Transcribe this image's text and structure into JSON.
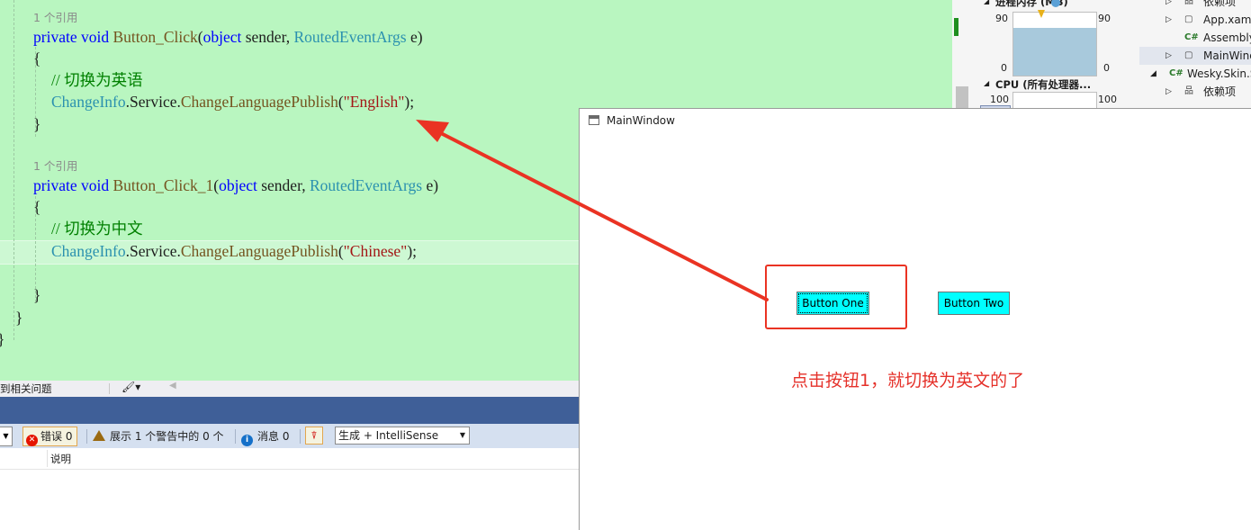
{
  "editor": {
    "ref1": "1 个引用",
    "method1": {
      "kw": "private void",
      "name": "Button_Click",
      "p1type": "object",
      "p1name": "sender,",
      "p2type": "RoutedEventArgs",
      "p2name": "e)"
    },
    "open_brace": "{",
    "close_brace": "}",
    "comment1": "// 切换为英语",
    "call1": {
      "cls": "ChangeInfo",
      "dot1": ".Service.",
      "method": "ChangeLanguagePublish",
      "arg": "\"English\"",
      "end": ");"
    },
    "ref2": "1 个引用",
    "method2": {
      "kw": "private void",
      "name": "Button_Click_1",
      "p1type": "object",
      "p1name": "sender,",
      "p2type": "RoutedEventArgs",
      "p2name": "e)"
    },
    "comment2": "// 切换为中文",
    "call2": {
      "cls": "ChangeInfo",
      "dot1": ".Service.",
      "method": "ChangeLanguagePublish",
      "arg": "\"Chinese\"",
      "end": ");"
    }
  },
  "status_strip": {
    "issues_text": "到相关问题"
  },
  "error_list": {
    "errors_label": "错误 0",
    "warnings_label": "展示 1 个警告中的 0 个",
    "messages_label": "消息 0",
    "build_filter": "生成 + IntelliSense",
    "column_description": "说明"
  },
  "diagnostics": {
    "memory_title": "进程内存 (MB)",
    "memory_max": "90",
    "memory_min": "0",
    "cpu_title": "CPU (所有处理器...",
    "cpu_max": "100"
  },
  "solution_explorer": {
    "items": [
      {
        "label": "依赖项"
      },
      {
        "label": "App.xaml"
      },
      {
        "label": "AssemblyInfo.cs"
      },
      {
        "label": "MainWindow.xaml"
      },
      {
        "label": "Wesky.Skin.S"
      },
      {
        "label": "依赖项"
      }
    ]
  },
  "wpf_window": {
    "title": "MainWindow",
    "button_one": "Button One",
    "button_two": "Button Two"
  },
  "annotation": {
    "note": "点击按钮1，就切换为英文的了",
    "color": "#e5312a"
  },
  "colors": {
    "editor_bg": "#b9f6c0",
    "keyword": "#0000ff",
    "type": "#2b91af",
    "string": "#a31515",
    "comment": "#008000",
    "button_bg": "#00ffff"
  }
}
